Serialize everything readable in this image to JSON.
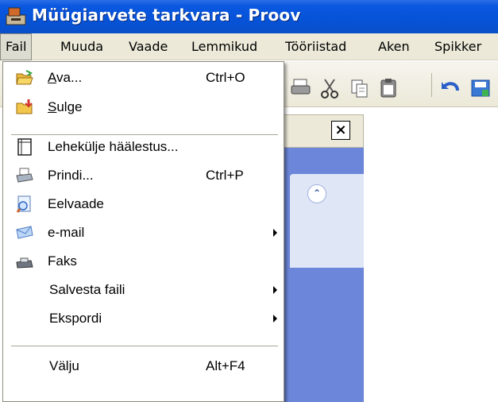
{
  "window": {
    "title": "Müügiarvete tarkvara - Proov"
  },
  "menubar": [
    {
      "label": "Fail",
      "active": true
    },
    {
      "label": "Muuda"
    },
    {
      "label": "Vaade"
    },
    {
      "label": "Lemmikud"
    },
    {
      "label": "Tööriistad"
    },
    {
      "label": "Aken"
    },
    {
      "label": "Spikker"
    }
  ],
  "file_menu": {
    "items": [
      {
        "label": "Ava...",
        "underline": "A",
        "rest": "va...",
        "shortcut": "Ctrl+O",
        "icon": "folder-open-icon"
      },
      {
        "label": "Sulge",
        "underline": "S",
        "rest": "ulge",
        "icon": "folder-close-icon"
      },
      {
        "label": "Lehekülje häälestus...",
        "icon": "page-setup-icon"
      },
      {
        "label": "Prindi...",
        "shortcut": "Ctrl+P",
        "icon": "printer-icon"
      },
      {
        "label": "Eelvaade",
        "icon": "print-preview-icon"
      },
      {
        "label": "e-mail",
        "submenu": true,
        "icon": "mail-icon"
      },
      {
        "label": "Faks",
        "icon": "fax-icon"
      },
      {
        "label": "Salvesta faili",
        "submenu": true
      },
      {
        "label": "Ekspordi",
        "submenu": true
      },
      {
        "label": "Välju",
        "shortcut": "Alt+F4"
      }
    ]
  },
  "toolbar": {
    "icons": [
      "printer-icon",
      "cut-icon",
      "copy-icon",
      "paste-icon",
      "undo-icon",
      "save-icon"
    ]
  },
  "panel": {
    "close_label": "×"
  },
  "colors": {
    "titlebar": "#0653d8",
    "menubar": "#ece9d8",
    "panel": "#6c86d9"
  }
}
